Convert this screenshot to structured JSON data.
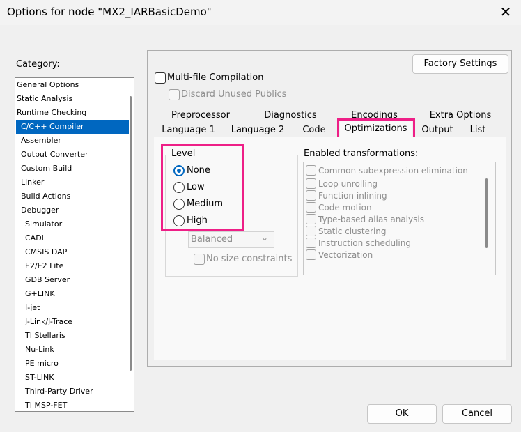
{
  "window": {
    "title": "Options for node \"MX2_IARBasicDemo\""
  },
  "category": {
    "label": "Category:",
    "items": [
      "General Options",
      "Static Analysis",
      "Runtime Checking",
      "C/C++ Compiler",
      "Assembler",
      "Output Converter",
      "Custom Build",
      "Linker",
      "Build Actions",
      "Debugger",
      "Simulator",
      "CADI",
      "CMSIS DAP",
      "E2/E2 Lite",
      "GDB Server",
      "G+LINK",
      "I-jet",
      "J-Link/J-Trace",
      "TI Stellaris",
      "Nu-Link",
      "PE micro",
      "ST-LINK",
      "Third-Party Driver",
      "TI MSP-FET"
    ],
    "selected": "C/C++ Compiler"
  },
  "buttons": {
    "factory": "Factory Settings",
    "ok": "OK",
    "cancel": "Cancel"
  },
  "multifile": {
    "label": "Multi-file Compilation",
    "discard": "Discard Unused Publics"
  },
  "tabs": {
    "row1": [
      "Preprocessor",
      "Diagnostics",
      "Encodings",
      "Extra Options"
    ],
    "row2": [
      "Language 1",
      "Language 2",
      "Code",
      "Optimizations",
      "Output",
      "List"
    ],
    "active": "Optimizations"
  },
  "level": {
    "title": "Level",
    "options": [
      "None",
      "Low",
      "Medium",
      "High"
    ],
    "selected": "None",
    "balance_select": "Balanced",
    "no_size": "No size constraints"
  },
  "transformations": {
    "title": "Enabled transformations:",
    "items": [
      "Common subexpression elimination",
      "Loop unrolling",
      "Function inlining",
      "Code motion",
      "Type-based alias analysis",
      "Static clustering",
      "Instruction scheduling",
      "Vectorization"
    ]
  },
  "colors": {
    "accent": "#0067c0",
    "highlight": "#ee1f87"
  }
}
